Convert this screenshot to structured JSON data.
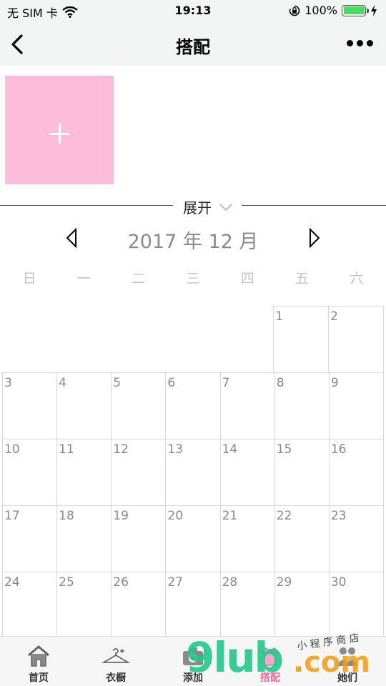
{
  "status_bar": {
    "carrier": "无 SIM 卡",
    "time": "19:13",
    "battery_percent": "100%",
    "battery_level": 1.0,
    "icons": [
      "wifi-icon",
      "orientation-lock-icon",
      "battery-icon",
      "charging-icon"
    ]
  },
  "nav": {
    "title": "搭配",
    "back_icon": "chevron-left-icon",
    "more_icon": "more-dots-icon"
  },
  "add_tile": {
    "icon": "plus-icon",
    "color": "#fdbcd9"
  },
  "expand": {
    "label": "展开",
    "icon": "chevron-down-icon"
  },
  "calendar": {
    "title": "2017 年 12 月",
    "prev_icon": "triangle-left-icon",
    "next_icon": "triangle-right-icon",
    "weekdays": [
      "日",
      "一",
      "二",
      "三",
      "四",
      "五",
      "六"
    ],
    "weeks": [
      [
        "",
        "",
        "",
        "",
        "",
        "1",
        "2"
      ],
      [
        "3",
        "4",
        "5",
        "6",
        "7",
        "8",
        "9"
      ],
      [
        "10",
        "11",
        "12",
        "13",
        "14",
        "15",
        "16"
      ],
      [
        "17",
        "18",
        "19",
        "20",
        "21",
        "22",
        "23"
      ],
      [
        "24",
        "25",
        "26",
        "27",
        "28",
        "29",
        "30"
      ]
    ]
  },
  "tab_bar": {
    "tabs": [
      {
        "label": "首页",
        "icon": "home-icon",
        "active": false
      },
      {
        "label": "衣橱",
        "icon": "hanger-icon",
        "active": false
      },
      {
        "label": "添加",
        "icon": "camera-icon",
        "active": false
      },
      {
        "label": "搭配",
        "icon": "outfit-icon",
        "active": true
      },
      {
        "label": "她们",
        "icon": "people-icon",
        "active": false
      }
    ],
    "active_color": "#f06ba0"
  },
  "watermark": {
    "main": "9lub",
    "domain": ".com",
    "sub": "小 程 序 商 店"
  }
}
